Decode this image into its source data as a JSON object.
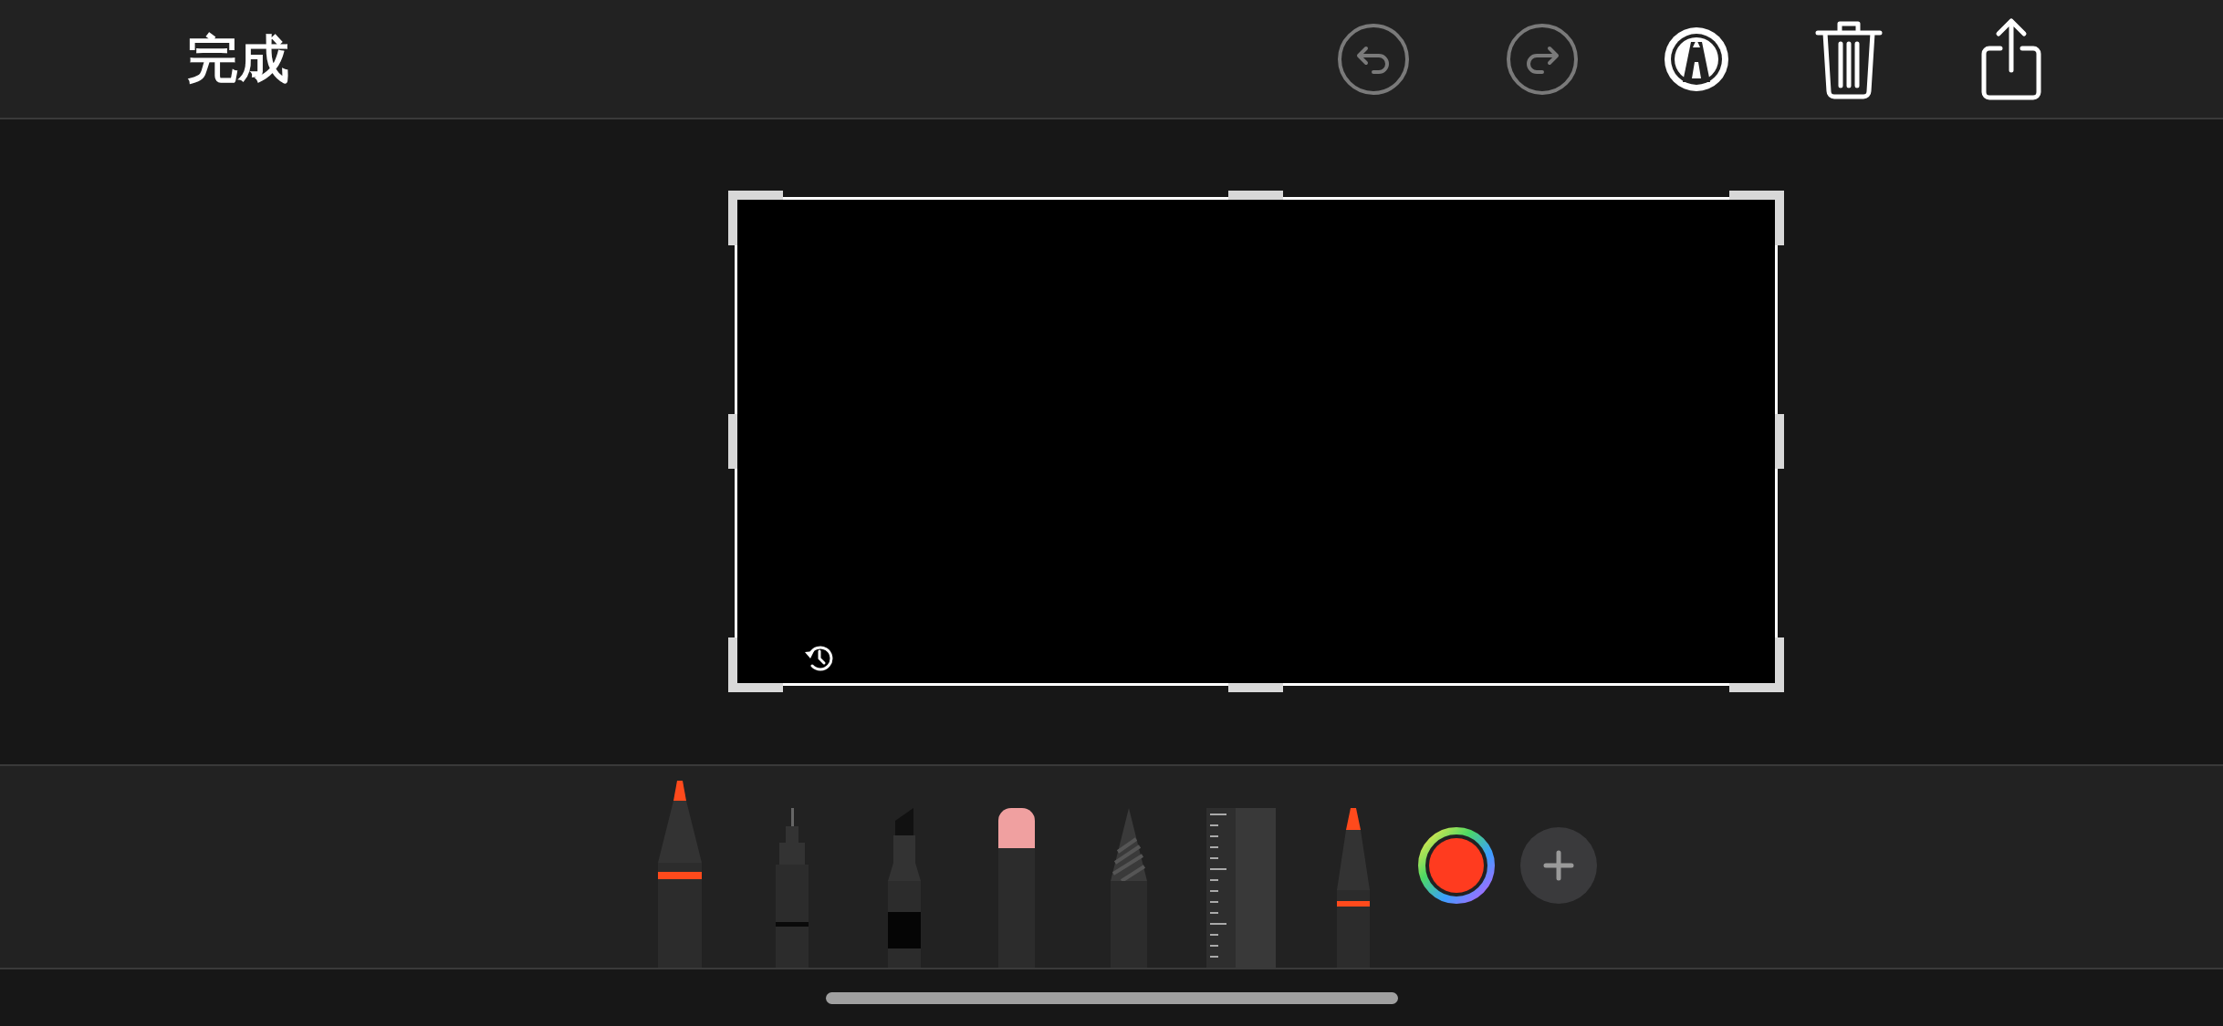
{
  "top_bar": {
    "done": "完成",
    "undo": {
      "disabled": true
    },
    "redo": {
      "disabled": true
    }
  },
  "tools": [
    {
      "kind": "pen",
      "selected": true
    },
    {
      "kind": "monoline",
      "selected": false
    },
    {
      "kind": "marker",
      "selected": false
    },
    {
      "kind": "eraser",
      "selected": false
    },
    {
      "kind": "lasso",
      "selected": false
    },
    {
      "kind": "ruler",
      "selected": false
    },
    {
      "kind": "pencil",
      "selected": false
    }
  ]
}
